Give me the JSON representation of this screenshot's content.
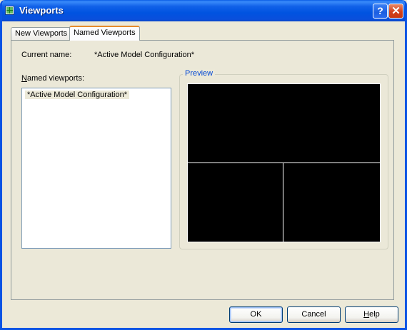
{
  "window": {
    "title": "Viewports",
    "icon": "viewports-app-icon"
  },
  "titlebar_buttons": {
    "help": "?",
    "close": "✕"
  },
  "tabs": [
    {
      "label": "New Viewports",
      "selected": false
    },
    {
      "label": "Named Viewports",
      "selected": true
    }
  ],
  "current": {
    "label": "Current name:",
    "value": "*Active Model Configuration*"
  },
  "named_viewports": {
    "label_prefix": "N",
    "label_rest": "amed viewports:",
    "items": [
      "*Active Model Configuration*"
    ]
  },
  "preview": {
    "title": "Preview"
  },
  "buttons": {
    "ok": "OK",
    "cancel": "Cancel",
    "help_prefix": "H",
    "help_rest": "elp"
  },
  "colors": {
    "title_bar": "#0a5de6",
    "dialog_bg": "#ece9d8",
    "group_title": "#0046d5",
    "preview_bg": "#000000"
  }
}
